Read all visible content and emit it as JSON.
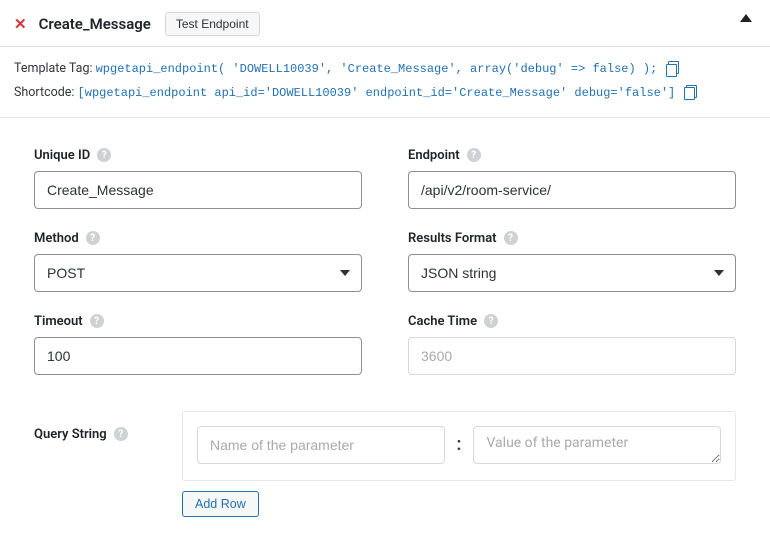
{
  "header": {
    "title": "Create_Message",
    "test_endpoint_label": "Test Endpoint"
  },
  "snippets": {
    "template_tag_label": "Template Tag: ",
    "template_tag_code": "wpgetapi_endpoint( 'DOWELL10039', 'Create_Message', array('debug' => false) );",
    "shortcode_label": "Shortcode: ",
    "shortcode_code": "[wpgetapi_endpoint api_id='DOWELL10039' endpoint_id='Create_Message' debug='false']"
  },
  "fields": {
    "unique_id": {
      "label": "Unique ID",
      "value": "Create_Message"
    },
    "endpoint": {
      "label": "Endpoint",
      "value": "/api/v2/room-service/"
    },
    "method": {
      "label": "Method",
      "value": "POST"
    },
    "results": {
      "label": "Results Format",
      "value": "JSON string"
    },
    "timeout": {
      "label": "Timeout",
      "value": "100"
    },
    "cache": {
      "label": "Cache Time",
      "placeholder": "3600"
    }
  },
  "query_string": {
    "label": "Query String",
    "name_placeholder": "Name of the parameter",
    "value_placeholder": "Value of the parameter",
    "add_row_label": "Add Row"
  },
  "icons": {
    "help_char": "?"
  }
}
